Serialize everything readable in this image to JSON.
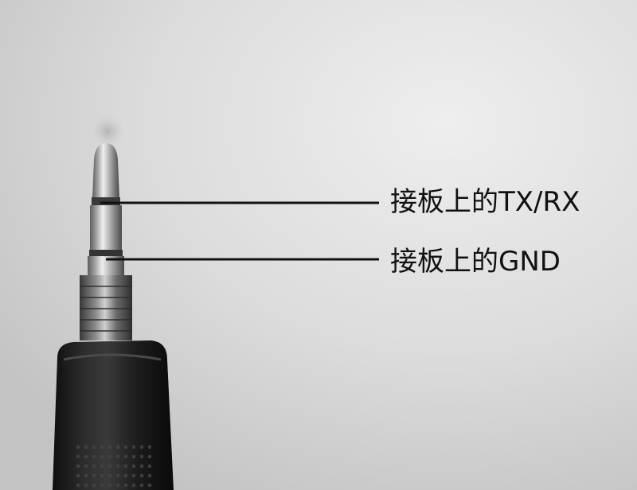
{
  "annotations": {
    "tip_label": "接板上的TX/RX",
    "sleeve_label": "接板上的GND"
  },
  "colors": {
    "background": "#d9d9d9",
    "callout_line": "#111111",
    "label_text": "#111111",
    "plug_metal": "#b8b8b8",
    "plug_handle": "#1e1e1e"
  },
  "subject": "audio-jack-plug"
}
